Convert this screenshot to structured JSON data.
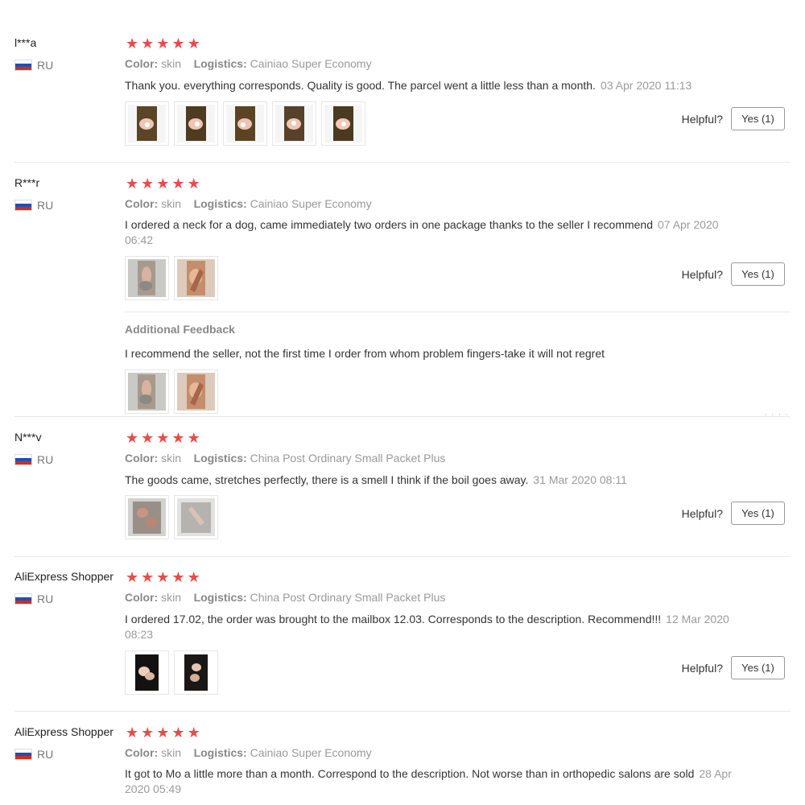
{
  "labels": {
    "color": "Color:",
    "logistics": "Logistics:",
    "helpful": "Helpful?",
    "additional_feedback": "Additional Feedback"
  },
  "star_glyph": "★",
  "colors": {
    "star": "#e94b4b",
    "date": "#9a9a9a"
  },
  "reviews": [
    {
      "user": "l***a",
      "country": "RU",
      "rating": 5,
      "color": "skin",
      "logistics": "Cainiao Super Economy",
      "text": "Thank you. everything corresponds. Quality is good. The parcel went a little less than a month.",
      "date": "03 Apr 2020 11:13",
      "helpful_button": "Yes (1)",
      "photos": 5
    },
    {
      "user": "R***r",
      "country": "RU",
      "rating": 5,
      "color": "skin",
      "logistics": "Cainiao Super Economy",
      "text": "I ordered a neck for a dog, came immediately two orders in one package thanks to the seller I recommend",
      "date": "07 Apr 2020 06:42",
      "helpful_button": "Yes (1)",
      "photos": 2,
      "additional_feedback": {
        "text": "I recommend the seller, not the first time I order from whom problem fingers-take it will not regret",
        "photos": 2
      }
    },
    {
      "user": "N***v",
      "country": "RU",
      "rating": 5,
      "color": "skin",
      "logistics": "China Post Ordinary Small Packet Plus",
      "text": "The goods came, stretches perfectly, there is a smell I think if the boil goes away.",
      "date": "31 Mar 2020 08:11",
      "helpful_button": "Yes (1)",
      "photos": 2
    },
    {
      "user": "AliExpress Shopper",
      "country": "RU",
      "rating": 5,
      "color": "skin",
      "logistics": "China Post Ordinary Small Packet Plus",
      "text": "I ordered 17.02, the order was brought to the mailbox 12.03. Corresponds to the description. Recommend!!!",
      "date": "12 Mar 2020 08:23",
      "helpful_button": "Yes (1)",
      "photos": 2
    },
    {
      "user": "AliExpress Shopper",
      "country": "RU",
      "rating": 5,
      "color": "skin",
      "logistics": "Cainiao Super Economy",
      "text": "It got to Mo a little more than a month. Correspond to the description. Not worse than in orthopedic salons are sold",
      "date": "28 Apr 2020 05:49"
    }
  ],
  "more_dots": "· · · ·"
}
